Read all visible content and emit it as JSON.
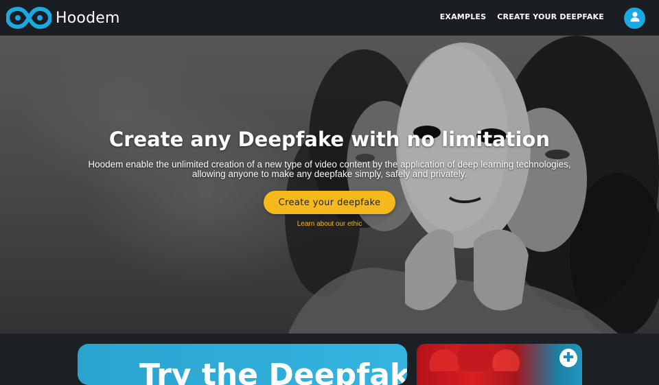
{
  "navbar": {
    "brand_name": "Hoodem",
    "logo_icon": "infinity-logo-icon",
    "links": [
      {
        "label": "EXAMPLES"
      },
      {
        "label": "CREATE YOUR DEEPFAKE"
      }
    ],
    "user_icon": "user-icon",
    "accent_color": "#1aa9e0"
  },
  "hero": {
    "title": "Create any Deepfake with no limitation",
    "description_line1": "Hoodem enable the unlimited creation of a new type of video content by the application of deep learning technologies,",
    "description_line2": "allowing anyone to make any deepfake simply, safely and privately.",
    "cta_label": "Create your deepfake",
    "ethic_link": "Learn about our ethic",
    "cta_color": "#f6b91d"
  },
  "cards": {
    "blue_card_title": "Try the Deepfake",
    "image_card_icon": "plus-circle-icon"
  }
}
